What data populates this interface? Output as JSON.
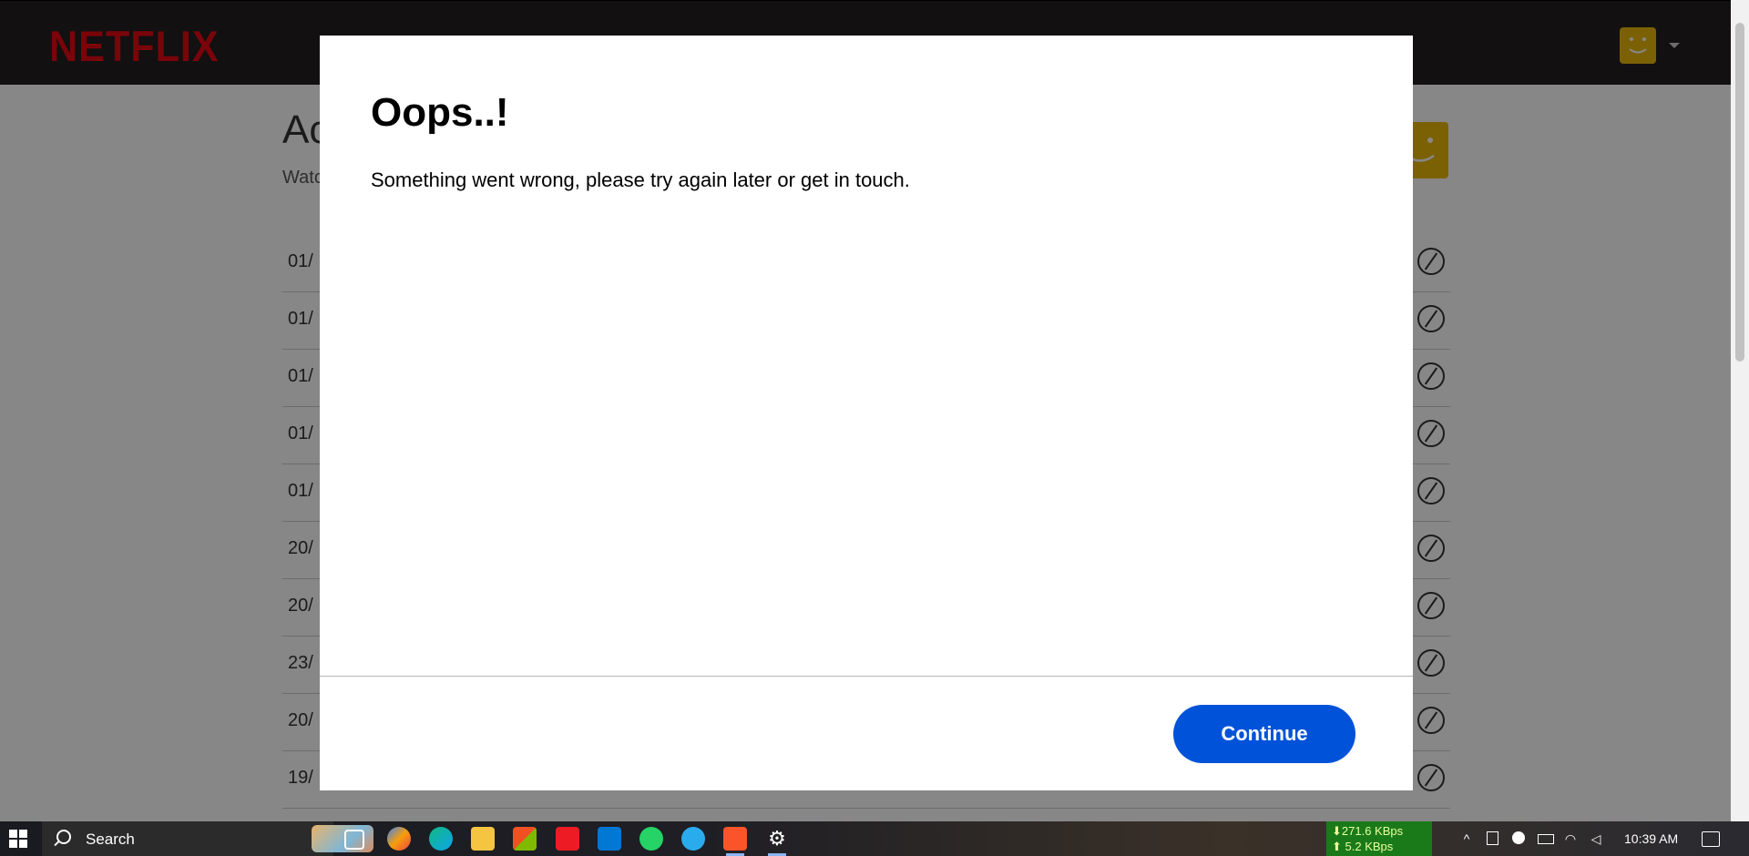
{
  "header": {
    "logo": "NETFLIX"
  },
  "page": {
    "title": "Ac",
    "subtitle": "Watc",
    "rows": [
      {
        "date": "01/"
      },
      {
        "date": "01/"
      },
      {
        "date": "01/"
      },
      {
        "date": "01/"
      },
      {
        "date": "01/"
      },
      {
        "date": "20/"
      },
      {
        "date": "20/"
      },
      {
        "date": "23/"
      },
      {
        "date": "20/"
      },
      {
        "date": "19/"
      }
    ]
  },
  "modal": {
    "title": "Oops..!",
    "message": "Something went wrong, please try again later or get in touch.",
    "continue_label": "Continue"
  },
  "taskbar": {
    "search_label": "Search",
    "download_speed": "⬇271.6 KBps",
    "upload_speed": "⬆ 5.2 KBps",
    "clock": "10:39 AM"
  },
  "colors": {
    "netflix_red": "#e50914",
    "header_bg": "#221f1f",
    "continue_blue": "#0053d8",
    "avatar_yellow": "#e8b708"
  }
}
